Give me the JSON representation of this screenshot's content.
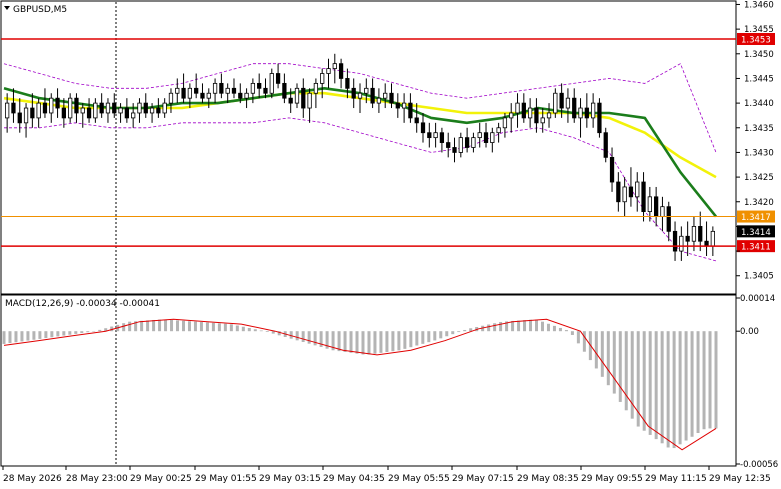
{
  "chart_title": "GBPUSD,M5",
  "macd_label": "MACD(12,26,9) -0.00034 -0.00041",
  "colors": {
    "bull": "#000000",
    "bear": "#000000",
    "ma_fast": "#1b7d1b",
    "ma_slow": "#f2f20a",
    "bands": "#a000c8",
    "support_line": "#e00000",
    "price_line": "#f09000",
    "macd_signal": "#e00000",
    "macd_hist": "#b4b4b4"
  },
  "chart_data": {
    "type": "candlestick",
    "symbol": "GBPUSD",
    "timeframe": "M5",
    "y_ticks": [
      "1.3460",
      "1.3455",
      "1.3450",
      "1.3445",
      "1.3440",
      "1.3435",
      "1.3430",
      "1.3425",
      "1.3420",
      "1.3415",
      "1.3410",
      "1.3405"
    ],
    "ylim": [
      1.34015,
      1.34605
    ],
    "horizontal_levels": [
      {
        "value": 1.3453,
        "label": "1.3453",
        "kind": "support_resistance"
      },
      {
        "value": 1.3411,
        "label": "1.3411",
        "kind": "support_resistance"
      },
      {
        "value": 1.3417,
        "label": "1.3417",
        "kind": "price"
      }
    ],
    "current_price": {
      "value": 1.3414,
      "label": "1.3414"
    },
    "x_ticks": [
      "28 May 2026",
      "28 May 23:00",
      "29 May 00:25",
      "29 May 01:55",
      "29 May 03:15",
      "29 May 04:35",
      "29 May 05:55",
      "29 May 07:15",
      "29 May 08:35",
      "29 May 09:55",
      "29 May 11:15",
      "29 May 12:35"
    ],
    "macd": {
      "params": "12,26,9",
      "main": -0.00034,
      "signal": -0.00041,
      "y_ticks": [
        "0.00014",
        "0.00",
        "-0.00056"
      ],
      "ylim": [
        -0.00056,
        0.00014
      ]
    },
    "candles": [
      [
        1.3437,
        1.3442,
        1.3434,
        1.344
      ],
      [
        1.344,
        1.3443,
        1.3436,
        1.3438
      ],
      [
        1.3438,
        1.3441,
        1.3434,
        1.3436
      ],
      [
        1.3436,
        1.344,
        1.3433,
        1.3439
      ],
      [
        1.3439,
        1.3442,
        1.3435,
        1.3437
      ],
      [
        1.3437,
        1.3441,
        1.3435,
        1.344
      ],
      [
        1.344,
        1.3443,
        1.3437,
        1.3438
      ],
      [
        1.3438,
        1.3442,
        1.3436,
        1.3441
      ],
      [
        1.3441,
        1.3443,
        1.3437,
        1.3439
      ],
      [
        1.3439,
        1.3441,
        1.3435,
        1.3437
      ],
      [
        1.3437,
        1.3442,
        1.3436,
        1.3441
      ],
      [
        1.3441,
        1.3442,
        1.3436,
        1.3438
      ],
      [
        1.3438,
        1.344,
        1.3435,
        1.3439
      ],
      [
        1.3439,
        1.3441,
        1.3436,
        1.3437
      ],
      [
        1.3437,
        1.3441,
        1.3436,
        1.344
      ],
      [
        1.344,
        1.3442,
        1.3437,
        1.3438
      ],
      [
        1.3438,
        1.3441,
        1.3436,
        1.344
      ],
      [
        1.344,
        1.3442,
        1.3437,
        1.3438
      ],
      [
        1.3438,
        1.344,
        1.3436,
        1.3439
      ],
      [
        1.3439,
        1.3441,
        1.3436,
        1.3437
      ],
      [
        1.3437,
        1.344,
        1.3435,
        1.3438
      ],
      [
        1.3438,
        1.3441,
        1.3436,
        1.344
      ],
      [
        1.344,
        1.3442,
        1.3437,
        1.3438
      ],
      [
        1.3438,
        1.344,
        1.3436,
        1.3439
      ],
      [
        1.3439,
        1.3441,
        1.3437,
        1.3438
      ],
      [
        1.3438,
        1.3441,
        1.3437,
        1.344
      ],
      [
        1.344,
        1.3443,
        1.3438,
        1.3442
      ],
      [
        1.3442,
        1.3445,
        1.344,
        1.3443
      ],
      [
        1.3443,
        1.3446,
        1.344,
        1.3441
      ],
      [
        1.3441,
        1.3444,
        1.3439,
        1.3443
      ],
      [
        1.3443,
        1.3446,
        1.3441,
        1.3442
      ],
      [
        1.3442,
        1.3444,
        1.344,
        1.3441
      ],
      [
        1.3441,
        1.3443,
        1.3439,
        1.3442
      ],
      [
        1.3442,
        1.3445,
        1.344,
        1.3444
      ],
      [
        1.3444,
        1.3446,
        1.3441,
        1.3442
      ],
      [
        1.3442,
        1.3444,
        1.344,
        1.3443
      ],
      [
        1.3443,
        1.3445,
        1.3441,
        1.3442
      ],
      [
        1.3442,
        1.3444,
        1.344,
        1.3441
      ],
      [
        1.3441,
        1.3443,
        1.3439,
        1.3442
      ],
      [
        1.3442,
        1.3445,
        1.344,
        1.3444
      ],
      [
        1.3444,
        1.3446,
        1.3441,
        1.3443
      ],
      [
        1.3443,
        1.3445,
        1.3441,
        1.3442
      ],
      [
        1.3442,
        1.3447,
        1.3441,
        1.3446
      ],
      [
        1.3446,
        1.3448,
        1.3443,
        1.3444
      ],
      [
        1.3444,
        1.3446,
        1.344,
        1.3441
      ],
      [
        1.3441,
        1.3443,
        1.3438,
        1.344
      ],
      [
        1.344,
        1.3444,
        1.3439,
        1.3443
      ],
      [
        1.3443,
        1.3445,
        1.3437,
        1.3439
      ],
      [
        1.3439,
        1.3443,
        1.3436,
        1.3442
      ],
      [
        1.3442,
        1.3445,
        1.3439,
        1.3444
      ],
      [
        1.3444,
        1.3447,
        1.3441,
        1.3446
      ],
      [
        1.3446,
        1.3449,
        1.3443,
        1.3447
      ],
      [
        1.3447,
        1.345,
        1.3444,
        1.3448
      ],
      [
        1.3448,
        1.3449,
        1.3443,
        1.3445
      ],
      [
        1.3445,
        1.3447,
        1.3441,
        1.3443
      ],
      [
        1.3443,
        1.3445,
        1.3439,
        1.3441
      ],
      [
        1.3441,
        1.3444,
        1.3438,
        1.3442
      ],
      [
        1.3442,
        1.3445,
        1.344,
        1.3443
      ],
      [
        1.3443,
        1.3445,
        1.3439,
        1.344
      ],
      [
        1.344,
        1.3443,
        1.3438,
        1.3441
      ],
      [
        1.3441,
        1.3444,
        1.3439,
        1.3442
      ],
      [
        1.3442,
        1.3444,
        1.3439,
        1.344
      ],
      [
        1.344,
        1.3442,
        1.3437,
        1.3439
      ],
      [
        1.3439,
        1.3442,
        1.3436,
        1.344
      ],
      [
        1.344,
        1.3442,
        1.3436,
        1.3437
      ],
      [
        1.3437,
        1.344,
        1.3434,
        1.3436
      ],
      [
        1.3436,
        1.3438,
        1.3432,
        1.3434
      ],
      [
        1.3434,
        1.3436,
        1.3431,
        1.3433
      ],
      [
        1.3433,
        1.3436,
        1.3431,
        1.3434
      ],
      [
        1.3434,
        1.3435,
        1.343,
        1.3432
      ],
      [
        1.3432,
        1.3434,
        1.3429,
        1.3431
      ],
      [
        1.3431,
        1.3433,
        1.3428,
        1.343
      ],
      [
        1.343,
        1.3434,
        1.3429,
        1.3433
      ],
      [
        1.3433,
        1.3435,
        1.343,
        1.3431
      ],
      [
        1.3431,
        1.3434,
        1.343,
        1.3433
      ],
      [
        1.3433,
        1.3436,
        1.3431,
        1.3434
      ],
      [
        1.3434,
        1.3436,
        1.3431,
        1.3432
      ],
      [
        1.3432,
        1.3435,
        1.343,
        1.3434
      ],
      [
        1.3434,
        1.3436,
        1.3432,
        1.3435
      ],
      [
        1.3435,
        1.3438,
        1.3433,
        1.3437
      ],
      [
        1.3437,
        1.344,
        1.3434,
        1.3438
      ],
      [
        1.3438,
        1.3442,
        1.3435,
        1.344
      ],
      [
        1.344,
        1.3442,
        1.3436,
        1.3437
      ],
      [
        1.3437,
        1.3441,
        1.3435,
        1.3439
      ],
      [
        1.3439,
        1.3441,
        1.3434,
        1.3436
      ],
      [
        1.3436,
        1.3439,
        1.3434,
        1.3437
      ],
      [
        1.3437,
        1.344,
        1.3435,
        1.3438
      ],
      [
        1.3438,
        1.3443,
        1.3437,
        1.3442
      ],
      [
        1.3442,
        1.3444,
        1.3437,
        1.3439
      ],
      [
        1.3439,
        1.3443,
        1.3436,
        1.3441
      ],
      [
        1.3441,
        1.3443,
        1.3436,
        1.3437
      ],
      [
        1.3437,
        1.3441,
        1.3433,
        1.3439
      ],
      [
        1.3439,
        1.3442,
        1.3435,
        1.3437
      ],
      [
        1.3437,
        1.3442,
        1.3435,
        1.344
      ],
      [
        1.344,
        1.3441,
        1.3433,
        1.3434
      ],
      [
        1.3434,
        1.3435,
        1.3428,
        1.3429
      ],
      [
        1.3429,
        1.3431,
        1.3422,
        1.3424
      ],
      [
        1.3424,
        1.3426,
        1.3418,
        1.342
      ],
      [
        1.342,
        1.3425,
        1.3417,
        1.3423
      ],
      [
        1.3423,
        1.3427,
        1.3419,
        1.3421
      ],
      [
        1.3421,
        1.3426,
        1.3418,
        1.3424
      ],
      [
        1.3424,
        1.3426,
        1.3416,
        1.3418
      ],
      [
        1.3418,
        1.3423,
        1.3416,
        1.3421
      ],
      [
        1.3421,
        1.3423,
        1.3415,
        1.3417
      ],
      [
        1.3417,
        1.3421,
        1.3414,
        1.3419
      ],
      [
        1.3419,
        1.342,
        1.3412,
        1.3414
      ],
      [
        1.3414,
        1.3416,
        1.3408,
        1.341
      ],
      [
        1.341,
        1.3415,
        1.3408,
        1.3413
      ],
      [
        1.3413,
        1.3416,
        1.3409,
        1.3412
      ],
      [
        1.3412,
        1.3417,
        1.341,
        1.3415
      ],
      [
        1.3415,
        1.3418,
        1.341,
        1.3412
      ],
      [
        1.3412,
        1.3416,
        1.3409,
        1.3411
      ],
      [
        1.3411,
        1.3415,
        1.3409,
        1.3414
      ]
    ],
    "ma_fast": [
      1.3443,
      1.3441,
      1.344,
      1.3439,
      1.3439,
      1.344,
      1.344,
      1.3441,
      1.3442,
      1.3443,
      1.3442,
      1.344,
      1.3437,
      1.3436,
      1.3437,
      1.3439,
      1.3438,
      1.3438,
      1.3437,
      1.3426,
      1.3417
    ],
    "ma_slow": [
      1.3441,
      1.344,
      1.3439,
      1.3439,
      1.3439,
      1.3439,
      1.344,
      1.3441,
      1.3442,
      1.3442,
      1.3441,
      1.344,
      1.3439,
      1.3438,
      1.3438,
      1.3438,
      1.3438,
      1.3437,
      1.3434,
      1.3429,
      1.3425
    ],
    "band_upper": [
      1.3448,
      1.3446,
      1.3444,
      1.3443,
      1.3443,
      1.3444,
      1.3446,
      1.3448,
      1.3448,
      1.3447,
      1.3446,
      1.3444,
      1.3442,
      1.3441,
      1.3442,
      1.3443,
      1.3444,
      1.3445,
      1.3444,
      1.3448,
      1.343
    ],
    "band_lower": [
      1.3435,
      1.3435,
      1.3436,
      1.3435,
      1.3435,
      1.3436,
      1.3436,
      1.3436,
      1.3437,
      1.3436,
      1.3434,
      1.3432,
      1.343,
      1.3431,
      1.3434,
      1.3435,
      1.3433,
      1.343,
      1.3418,
      1.341,
      1.3408
    ],
    "macd_signal": [
      -6e-05,
      -4e-05,
      -2e-05,
      0.0,
      4e-05,
      5e-05,
      4e-05,
      3e-05,
      0.0,
      -4e-05,
      -8e-05,
      -0.0001,
      -8e-05,
      -4e-05,
      1e-05,
      4e-05,
      5e-05,
      0.0,
      -0.0002,
      -0.0004,
      -0.0005,
      -0.00041
    ]
  }
}
